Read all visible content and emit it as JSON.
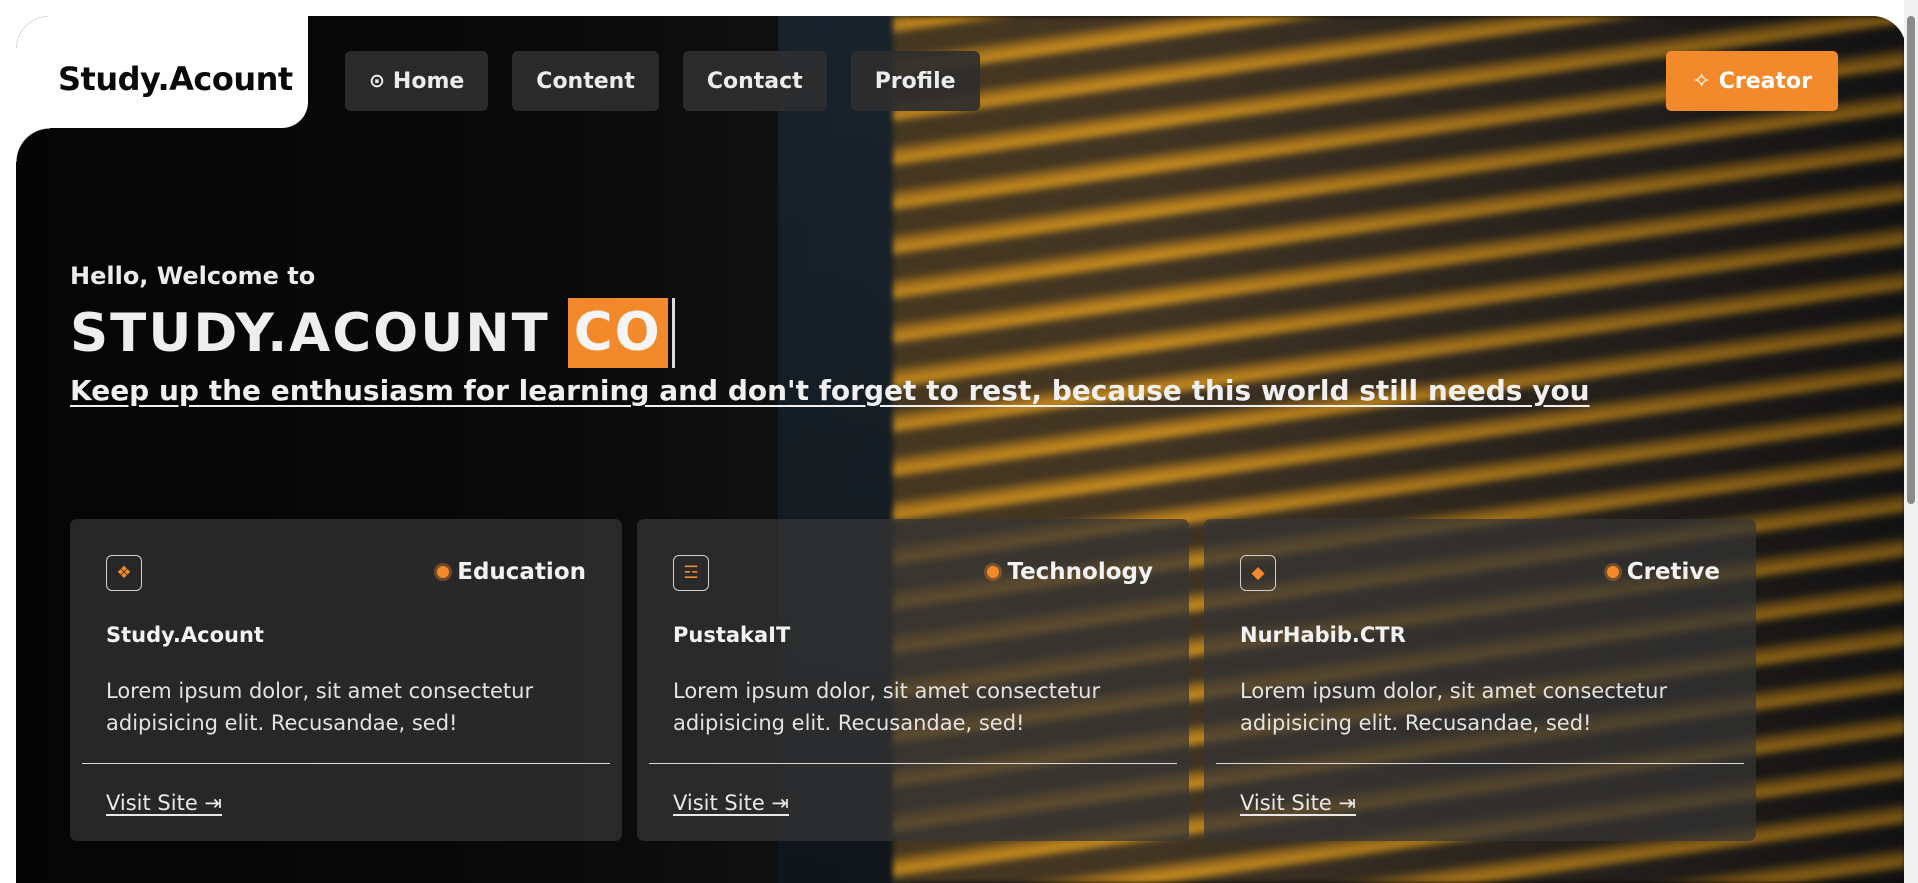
{
  "brand": {
    "logo_text": "Study.Acount"
  },
  "nav": {
    "items": [
      {
        "label": "Home",
        "icon": "home-circle-icon",
        "icon_glyph": "⊙"
      },
      {
        "label": "Content"
      },
      {
        "label": "Contact"
      },
      {
        "label": "Profile"
      }
    ],
    "creator": {
      "label": "Creator",
      "icon": "sparkle-icon",
      "icon_glyph": "✧"
    }
  },
  "hero": {
    "welcome": "Hello, Welcome to",
    "title_main": "STUDY.ACOUNT",
    "title_typed": "CO",
    "tagline": "Keep up the enthusiasm for learning and don't forget to rest, because this world still needs you"
  },
  "cards": [
    {
      "icon": "diamond-grid-icon",
      "icon_glyph": "❖",
      "category": "Education",
      "title": "Study.Acount",
      "description": "Lorem ipsum dolor, sit amet consectetur adipisicing elit. Recusandae, sed!",
      "link": "Visit Site ⇥"
    },
    {
      "icon": "list-lines-icon",
      "icon_glyph": "☲",
      "category": "Technology",
      "title": "PustakaIT",
      "description": "Lorem ipsum dolor, sit amet consectetur adipisicing elit. Recusandae, sed!",
      "link": "Visit Site ⇥"
    },
    {
      "icon": "diamond-icon",
      "icon_glyph": "◆",
      "category": "Cretive",
      "title": "NurHabib.CTR",
      "description": "Lorem ipsum dolor, sit amet consectetur adipisicing elit. Recusandae, sed!",
      "link": "Visit Site ⇥"
    }
  ],
  "colors": {
    "accent": "#f28a2c",
    "nav_bg": "#2e2e2e",
    "card_bg": "#343434",
    "text_light": "#ececec"
  }
}
